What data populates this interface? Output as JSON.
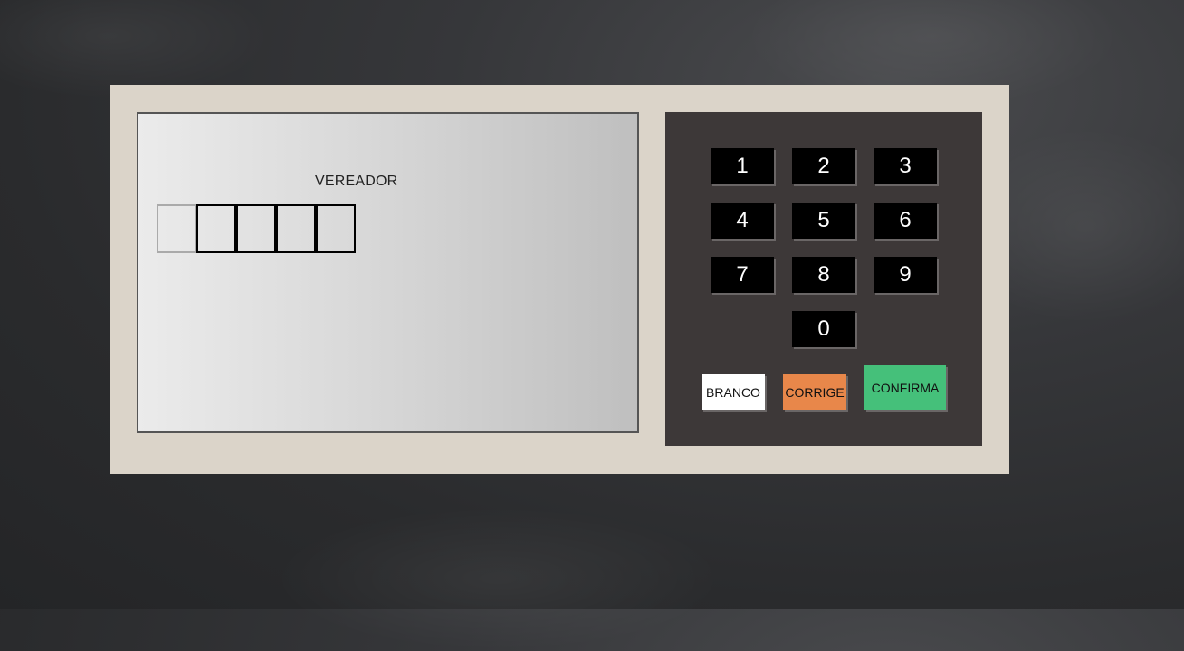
{
  "screen": {
    "cargo": "VEREADOR",
    "digitos": [
      "",
      "",
      "",
      "",
      ""
    ]
  },
  "keypad": {
    "keys": [
      "1",
      "2",
      "3",
      "4",
      "5",
      "6",
      "7",
      "8",
      "9",
      "0"
    ]
  },
  "actions": {
    "branco": "BRANCO",
    "corrige": "CORRIGE",
    "confirma": "CONFIRMA"
  },
  "colors": {
    "background": "#2f3032",
    "body": "#dbd4c9",
    "keypad": "#3d3838",
    "key": "#000000",
    "branco": "#ffffff",
    "corrige": "#e8874a",
    "confirma": "#45c07a"
  }
}
